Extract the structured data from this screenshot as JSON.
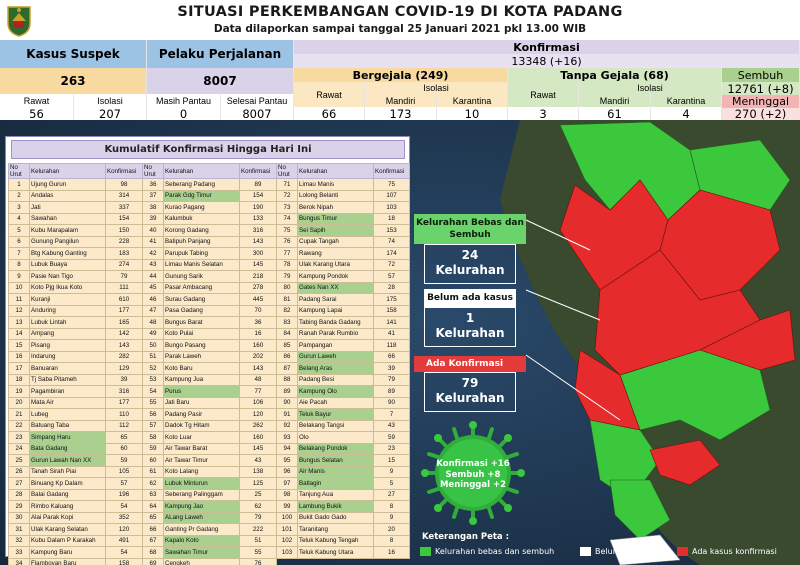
{
  "header": {
    "title": "SITUASI PERKEMBANGAN COVID-19 DI KOTA PADANG",
    "subtitle": "Data dilaporkan sampai tanggal 25 Januari 2021 pkl 13.00 WIB"
  },
  "stats": {
    "suspek": {
      "label": "Kasus Suspek",
      "total": "263",
      "rawat_label": "Rawat",
      "rawat": "56",
      "isolasi_label": "Isolasi",
      "isolasi": "207"
    },
    "perjalanan": {
      "label": "Pelaku Perjalanan",
      "total": "8007",
      "masih_label": "Masih Pantau",
      "masih": "0",
      "selesai_label": "Selesai Pantau",
      "selesai": "8007"
    },
    "konfirmasi": {
      "label": "Konfirmasi",
      "total": "13348 (+16)",
      "bergejala": {
        "label": "Bergejala (249)",
        "rawat_label": "Rawat",
        "rawat": "66",
        "isolasi_label": "Isolasi",
        "mandiri_label": "Mandiri",
        "mandiri": "173",
        "karantina_label": "Karantina",
        "karantina": "10"
      },
      "tanpa_gejala": {
        "label": "Tanpa Gejala (68)",
        "rawat_label": "Rawat",
        "rawat": "3",
        "isolasi_label": "Isolasi",
        "mandiri_label": "Mandiri",
        "mandiri": "61",
        "karantina_label": "Karantina",
        "karantina": "4"
      },
      "sembuh": {
        "label": "Sembuh",
        "value": "12761 (+8)"
      },
      "meninggal": {
        "label": "Meninggal",
        "value": "270 (+2)"
      }
    }
  },
  "table": {
    "title": "Kumulatif Konfirmasi Hingga Hari Ini",
    "headers": {
      "no": "No Urut",
      "kel": "Kelurahan",
      "konf": "Konfirmasi"
    },
    "rows": [
      {
        "no": "1",
        "name": "Ujung Gurun",
        "val": "98",
        "green": false
      },
      {
        "no": "2",
        "name": "Andalas",
        "val": "314",
        "green": false
      },
      {
        "no": "3",
        "name": "Jati",
        "val": "337",
        "green": false
      },
      {
        "no": "4",
        "name": "Sawahan",
        "val": "154",
        "green": false
      },
      {
        "no": "5",
        "name": "Kubu Marapalam",
        "val": "150",
        "green": false
      },
      {
        "no": "6",
        "name": "Gunung Pangilun",
        "val": "228",
        "green": false
      },
      {
        "no": "7",
        "name": "Btg Kabung Ganting",
        "val": "183",
        "green": false
      },
      {
        "no": "8",
        "name": "Lubuk Buaya",
        "val": "274",
        "green": false
      },
      {
        "no": "9",
        "name": "Pasie Nan Tigo",
        "val": "79",
        "green": false
      },
      {
        "no": "10",
        "name": "Koto Pjg Ikua Koto",
        "val": "111",
        "green": false
      },
      {
        "no": "11",
        "name": "Kuranji",
        "val": "610",
        "green": false
      },
      {
        "no": "12",
        "name": "Anduring",
        "val": "177",
        "green": false
      },
      {
        "no": "13",
        "name": "Lubuk Lintah",
        "val": "165",
        "green": false
      },
      {
        "no": "14",
        "name": "Ampang",
        "val": "142",
        "green": false
      },
      {
        "no": "15",
        "name": "Pisang",
        "val": "143",
        "green": false
      },
      {
        "no": "16",
        "name": "Indarung",
        "val": "282",
        "green": false
      },
      {
        "no": "17",
        "name": "Banuaran",
        "val": "129",
        "green": false
      },
      {
        "no": "18",
        "name": "Tj Saba Pitameh",
        "val": "39",
        "green": false
      },
      {
        "no": "19",
        "name": "Pagambiran",
        "val": "316",
        "green": false
      },
      {
        "no": "20",
        "name": "Mata Air",
        "val": "177",
        "green": false
      },
      {
        "no": "21",
        "name": "Lubeg",
        "val": "110",
        "green": false
      },
      {
        "no": "22",
        "name": "Batuang Taba",
        "val": "112",
        "green": false
      },
      {
        "no": "23",
        "name": "Simpang Haru",
        "val": "65",
        "green": true
      },
      {
        "no": "24",
        "name": "Bata Gadang",
        "val": "60",
        "green": true
      },
      {
        "no": "25",
        "name": "Gurun Lawah Nan XX",
        "val": "59",
        "green": true
      },
      {
        "no": "26",
        "name": "Tanah Sirah Piai",
        "val": "105",
        "green": false
      },
      {
        "no": "27",
        "name": "Binuang Kp Dalam",
        "val": "57",
        "green": false
      },
      {
        "no": "28",
        "name": "Balai Gadang",
        "val": "196",
        "green": false
      },
      {
        "no": "29",
        "name": "Rimbo Kaluang",
        "val": "54",
        "green": false
      },
      {
        "no": "30",
        "name": "Alai Parak Kopi",
        "val": "352",
        "green": false
      },
      {
        "no": "31",
        "name": "Ulak Karang Selatan",
        "val": "120",
        "green": false
      },
      {
        "no": "32",
        "name": "Kubu Dalam P Karakah",
        "val": "491",
        "green": false
      },
      {
        "no": "33",
        "name": "Kampung Baru",
        "val": "54",
        "green": false
      },
      {
        "no": "34",
        "name": "Flamboyan Baru",
        "val": "158",
        "green": false
      },
      {
        "no": "35",
        "name": "Bandar Buat",
        "val": "238",
        "green": false
      },
      {
        "no": "36",
        "name": "Seberang Padang",
        "val": "89",
        "green": false
      },
      {
        "no": "37",
        "name": "Parak Gdg Timur",
        "val": "154",
        "green": true
      },
      {
        "no": "38",
        "name": "Kurao Pagang",
        "val": "190",
        "green": false
      },
      {
        "no": "39",
        "name": "Kalumbuk",
        "val": "133",
        "green": false
      },
      {
        "no": "40",
        "name": "Korong Gadang",
        "val": "316",
        "green": false
      },
      {
        "no": "41",
        "name": "Batipuh Panjang",
        "val": "143",
        "green": false
      },
      {
        "no": "42",
        "name": "Parupuk Tabing",
        "val": "300",
        "green": false
      },
      {
        "no": "43",
        "name": "Limau Manis Selatan",
        "val": "145",
        "green": false
      },
      {
        "no": "44",
        "name": "Gunung Sarik",
        "val": "218",
        "green": false
      },
      {
        "no": "45",
        "name": "Pasar Ambacang",
        "val": "278",
        "green": false
      },
      {
        "no": "46",
        "name": "Surau Gadang",
        "val": "445",
        "green": false
      },
      {
        "no": "47",
        "name": "Pasa Gadang",
        "val": "70",
        "green": false
      },
      {
        "no": "48",
        "name": "Bungus Barat",
        "val": "36",
        "green": false
      },
      {
        "no": "49",
        "name": "Koto Pulai",
        "val": "16",
        "green": false
      },
      {
        "no": "50",
        "name": "Bungo Pasang",
        "val": "160",
        "green": false
      },
      {
        "no": "51",
        "name": "Parak Laweh",
        "val": "202",
        "green": false
      },
      {
        "no": "52",
        "name": "Koto Baru",
        "val": "143",
        "green": false
      },
      {
        "no": "53",
        "name": "Kampung Jua",
        "val": "48",
        "green": false
      },
      {
        "no": "54",
        "name": "Purus",
        "val": "77",
        "green": true
      },
      {
        "no": "55",
        "name": "Jati Baru",
        "val": "106",
        "green": false
      },
      {
        "no": "56",
        "name": "Padang Pasir",
        "val": "120",
        "green": false
      },
      {
        "no": "57",
        "name": "Dadok Tg Hitam",
        "val": "262",
        "green": false
      },
      {
        "no": "58",
        "name": "Koto Luar",
        "val": "160",
        "green": false
      },
      {
        "no": "59",
        "name": "Air Tawar Barat",
        "val": "145",
        "green": false
      },
      {
        "no": "60",
        "name": "Air Tawar Timur",
        "val": "43",
        "green": false
      },
      {
        "no": "61",
        "name": "Koto Lalang",
        "val": "138",
        "green": false
      },
      {
        "no": "62",
        "name": "Lubuk Minturun",
        "val": "125",
        "green": true
      },
      {
        "no": "63",
        "name": "Seberang Palinggam",
        "val": "25",
        "green": false
      },
      {
        "no": "64",
        "name": "Kampung Jao",
        "val": "62",
        "green": true
      },
      {
        "no": "65",
        "name": "ALang Laweh",
        "val": "79",
        "green": true
      },
      {
        "no": "66",
        "name": "Ganting Pr Gadang",
        "val": "222",
        "green": false
      },
      {
        "no": "67",
        "name": "Kapalo Koto",
        "val": "51",
        "green": true
      },
      {
        "no": "68",
        "name": "Sawahan Timur",
        "val": "55",
        "green": true
      },
      {
        "no": "69",
        "name": "Cengkeh",
        "val": "76",
        "green": false
      },
      {
        "no": "70",
        "name": "Pilai Tangah",
        "val": "84",
        "green": false
      },
      {
        "no": "71",
        "name": "Limau Manis",
        "val": "75",
        "green": false
      },
      {
        "no": "72",
        "name": "Lolong Belanti",
        "val": "107",
        "green": false
      },
      {
        "no": "73",
        "name": "Berok Nipah",
        "val": "103",
        "green": false
      },
      {
        "no": "74",
        "name": "Bungus Timur",
        "val": "18",
        "green": true
      },
      {
        "no": "75",
        "name": "Sei Sapih",
        "val": "153",
        "green": true
      },
      {
        "no": "76",
        "name": "Cupak Tangah",
        "val": "74",
        "green": false
      },
      {
        "no": "77",
        "name": "Rawang",
        "val": "174",
        "green": false
      },
      {
        "no": "78",
        "name": "Ulak Karang Utara",
        "val": "72",
        "green": false
      },
      {
        "no": "79",
        "name": "Kampung Pondok",
        "val": "57",
        "green": false
      },
      {
        "no": "80",
        "name": "Gates Nan XX",
        "val": "28",
        "green": true
      },
      {
        "no": "81",
        "name": "Padang Sarai",
        "val": "175",
        "green": false
      },
      {
        "no": "82",
        "name": "Kampung Lapai",
        "val": "158",
        "green": false
      },
      {
        "no": "83",
        "name": "Tabing Banda Gadang",
        "val": "141",
        "green": false
      },
      {
        "no": "84",
        "name": "Ranah Parak Rumbio",
        "val": "41",
        "green": false
      },
      {
        "no": "85",
        "name": "Pampangan",
        "val": "118",
        "green": false
      },
      {
        "no": "86",
        "name": "Gurun Laweh",
        "val": "66",
        "green": true
      },
      {
        "no": "87",
        "name": "Belang Aras",
        "val": "39",
        "green": true
      },
      {
        "no": "88",
        "name": "Padang Besi",
        "val": "79",
        "green": false
      },
      {
        "no": "89",
        "name": "Kampung Olo",
        "val": "89",
        "green": true
      },
      {
        "no": "90",
        "name": "Aie Pacah",
        "val": "90",
        "green": false
      },
      {
        "no": "91",
        "name": "Teluk Bayur",
        "val": "7",
        "green": true
      },
      {
        "no": "92",
        "name": "Belakang Tangsi",
        "val": "43",
        "green": false
      },
      {
        "no": "93",
        "name": "Olo",
        "val": "59",
        "green": false
      },
      {
        "no": "94",
        "name": "Belakang Pondok",
        "val": "23",
        "green": true
      },
      {
        "no": "95",
        "name": "Bungus Selatan",
        "val": "15",
        "green": true
      },
      {
        "no": "96",
        "name": "Air Manis",
        "val": "9",
        "green": true
      },
      {
        "no": "97",
        "name": "Batlagin",
        "val": "5",
        "green": true
      },
      {
        "no": "98",
        "name": "Tanjung Aua",
        "val": "27",
        "green": false
      },
      {
        "no": "99",
        "name": "Lambung Bukik",
        "val": "8",
        "green": true
      },
      {
        "no": "100",
        "name": "Bukit Gado Gado",
        "val": "9",
        "green": false
      },
      {
        "no": "101",
        "name": "Taranitang",
        "val": "20",
        "green": false
      },
      {
        "no": "102",
        "name": "Teluk Kabung Tengah",
        "val": "8",
        "green": false
      },
      {
        "no": "103",
        "name": "Teluk Kabung Utara",
        "val": "16",
        "green": false
      }
    ]
  },
  "callouts": {
    "bebas": {
      "title": "Kelurahan Bebas dan Sembuh",
      "count": "24",
      "unit": "Kelurahan"
    },
    "belum": {
      "title": "Belum ada kasus",
      "count": "1",
      "unit": "Kelurahan"
    },
    "ada": {
      "title": "Ada Konfirmasi",
      "count": "79",
      "unit": "Kelurahan"
    }
  },
  "virus": {
    "line1": "Konfirmasi +16",
    "line2": "Sembuh +8",
    "line3": "Meninggal +2"
  },
  "legend": {
    "title": "Keterangan Peta :",
    "items": [
      {
        "label": "Kelurahan bebas dan sembuh",
        "color": "#3cc83c"
      },
      {
        "label": "Belum ada kasus",
        "color": "#ffffff"
      },
      {
        "label": "Ada kasus konfirmasi",
        "color": "#e52b2b"
      }
    ]
  },
  "colors": {
    "red": "#e52b2b",
    "green": "#3cc83c",
    "sea": "#1d3550"
  }
}
